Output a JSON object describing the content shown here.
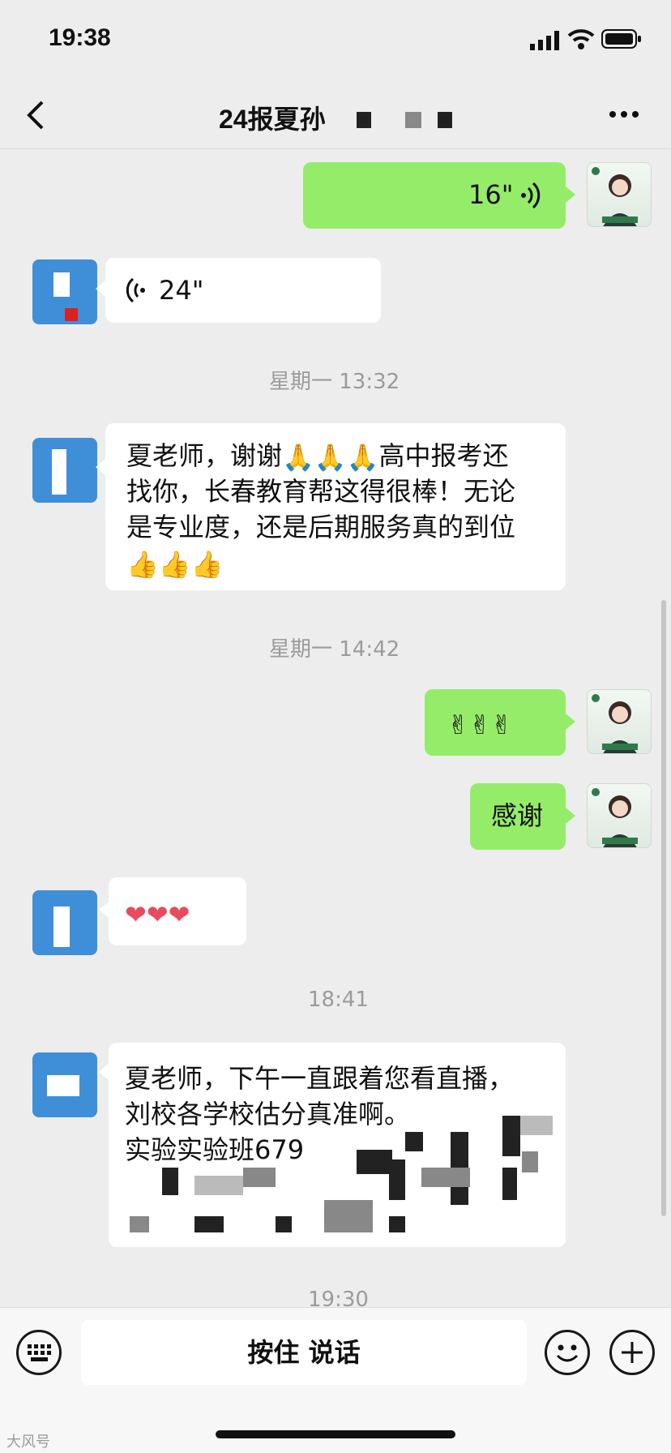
{
  "status_bar": {
    "time": "19:38"
  },
  "nav": {
    "title": "24报夏孙"
  },
  "messages": {
    "voice_out": "16\"",
    "voice_in": "24\"",
    "ts1": "星期一 13:32",
    "msg1_line1a": "夏老师，谢谢",
    "msg1_line1b": "高中报考还",
    "msg1_line2": "找你，长春教育帮这得很棒！无论",
    "msg1_line3": "是专业度，还是后期服务真的到位",
    "ts2": "星期一 14:42",
    "thanks": "感谢",
    "ts3": "18:41",
    "msg2_line1": "夏老师，下午一直跟着您看直播，",
    "msg2_line2": "刘校各学校估分真准啊。",
    "msg2_line3": "实验实验班679",
    "ts4": "19:30"
  },
  "input": {
    "talk_label": "按住 说话"
  },
  "watermark": "大风号"
}
